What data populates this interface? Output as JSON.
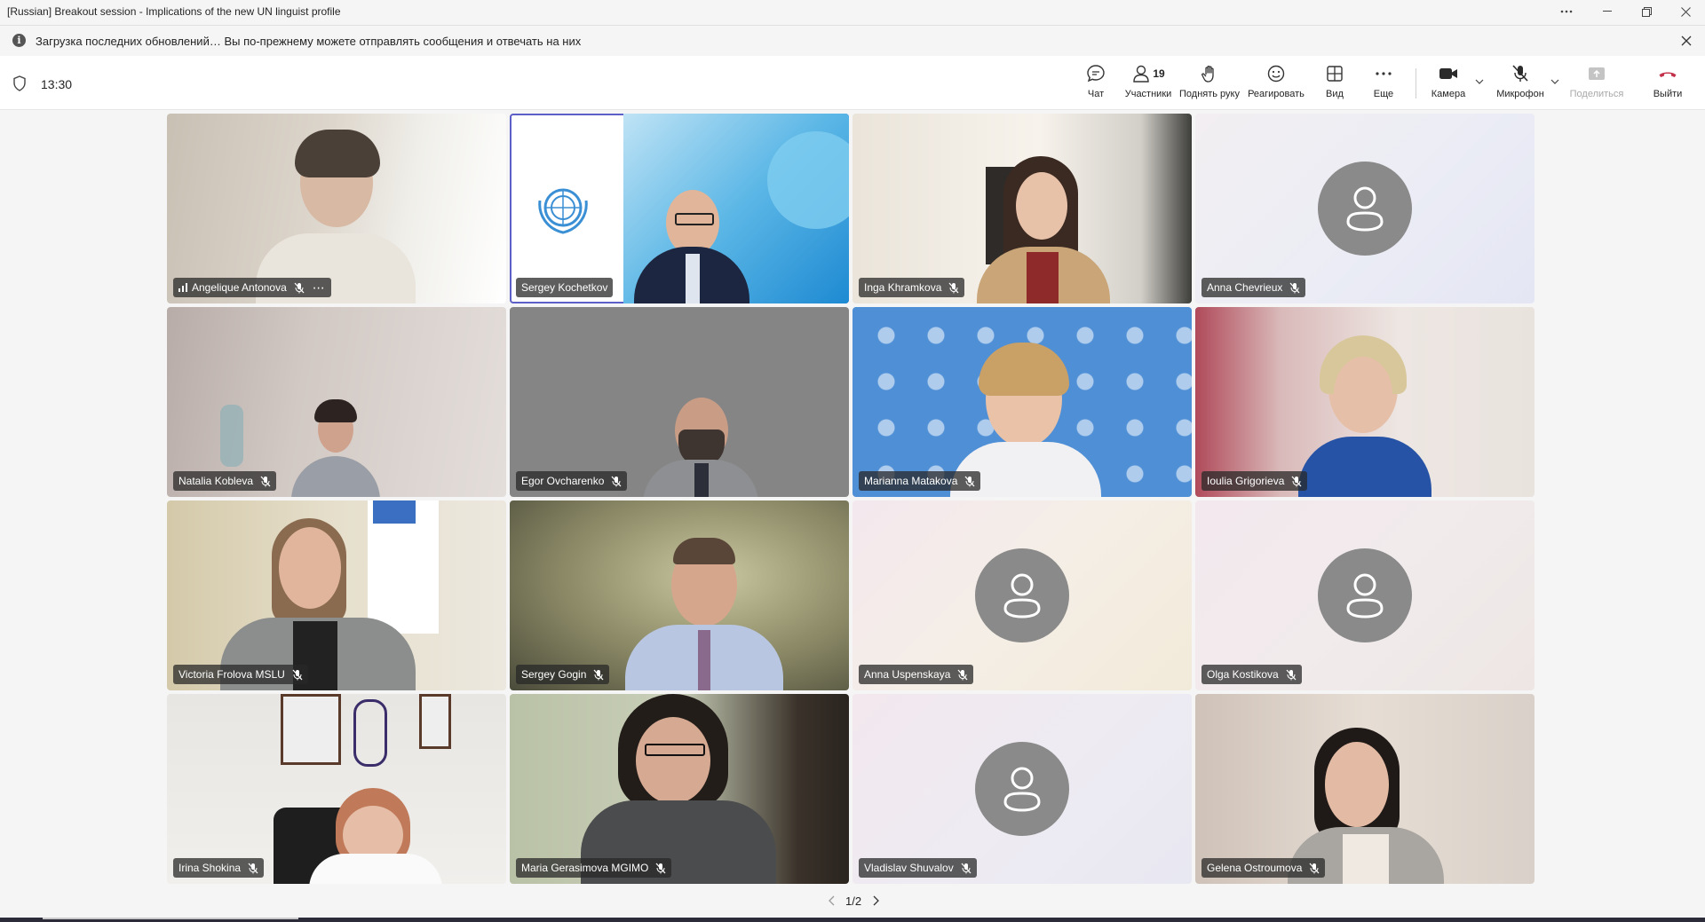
{
  "window": {
    "title": "[Russian] Breakout session - Implications of the new UN linguist profile"
  },
  "notification": {
    "message": "Загрузка последних обновлений… Вы по-прежнему можете отправлять сообщения и отвечать на них"
  },
  "toolbar": {
    "time": "13:30",
    "chat": "Чат",
    "participants": "Участники",
    "participants_count": "19",
    "raise_hand": "Поднять руку",
    "react": "Реагировать",
    "view": "Вид",
    "more": "Еще",
    "camera": "Камера",
    "microphone": "Микрофон",
    "share": "Поделиться",
    "leave": "Выйти"
  },
  "participants": [
    {
      "name": "Angelique Antonova",
      "video": true
    },
    {
      "name": "Sergey Kochetkov",
      "video": true,
      "active": true
    },
    {
      "name": "Inga Khramkova",
      "video": true
    },
    {
      "name": "Anna Chevrieux",
      "video": false
    },
    {
      "name": "Natalia Kobleva",
      "video": true
    },
    {
      "name": "Egor Ovcharenko",
      "video": true
    },
    {
      "name": "Marianna Matakova",
      "video": true
    },
    {
      "name": "Ioulia Grigorieva",
      "video": true
    },
    {
      "name": "Victoria Frolova MSLU",
      "video": true
    },
    {
      "name": "Sergey Gogin",
      "video": true
    },
    {
      "name": "Anna Uspenskaya",
      "video": false
    },
    {
      "name": "Olga Kostikova",
      "video": false
    },
    {
      "name": "Irina Shokina",
      "video": true
    },
    {
      "name": "Maria Gerasimova MGIMO",
      "video": true
    },
    {
      "name": "Vladislav Shuvalov",
      "video": false
    },
    {
      "name": "Gelena Ostroumova",
      "video": true
    }
  ],
  "pagination": {
    "label": "1/2"
  },
  "colors": {
    "accent": "#5b5fc7",
    "leave": "#c4314b"
  }
}
